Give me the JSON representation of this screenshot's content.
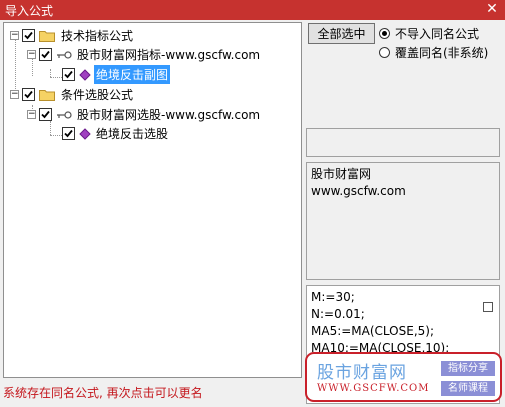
{
  "window": {
    "title": "导入公式",
    "close_glyph": "✕"
  },
  "tree": {
    "groups": [
      {
        "label": "技术指标公式",
        "checked": true,
        "source": {
          "label": "股市财富网指标-www.gscfw.com",
          "checked": true,
          "formula": {
            "label": "绝境反击副图",
            "checked": true,
            "selected": true
          }
        }
      },
      {
        "label": "条件选股公式",
        "checked": true,
        "source": {
          "label": "股市财富网选股-www.gscfw.com",
          "checked": true,
          "formula": {
            "label": "绝境反击选股",
            "checked": true,
            "selected": false
          }
        }
      }
    ],
    "expander_glyph": "−"
  },
  "controls": {
    "select_all_label": "全部选中",
    "radio_no_import": "不导入同名公式",
    "radio_overwrite": "覆盖同名(非系统)",
    "selected_radio": "no_import"
  },
  "info": {
    "line1": "股市财富网",
    "line2": "www.gscfw.com"
  },
  "code": {
    "lines": [
      "M:=30;",
      "N:=0.01;",
      "MA5:=MA(CLOSE,5);",
      "MA10:=MA(CLOSE,10);"
    ]
  },
  "watermark": {
    "title": "股市财富网",
    "url": "WWW.GSCFW.COM",
    "tag1": "指标分享",
    "tag2": "名师课程"
  },
  "status": {
    "message": "系统存在同名公式, 再次点击可以更名"
  },
  "colors": {
    "titlebar": "#c6322f",
    "selection": "#3399ff",
    "status_text": "#c4161c",
    "watermark_border": "#c9202a"
  }
}
